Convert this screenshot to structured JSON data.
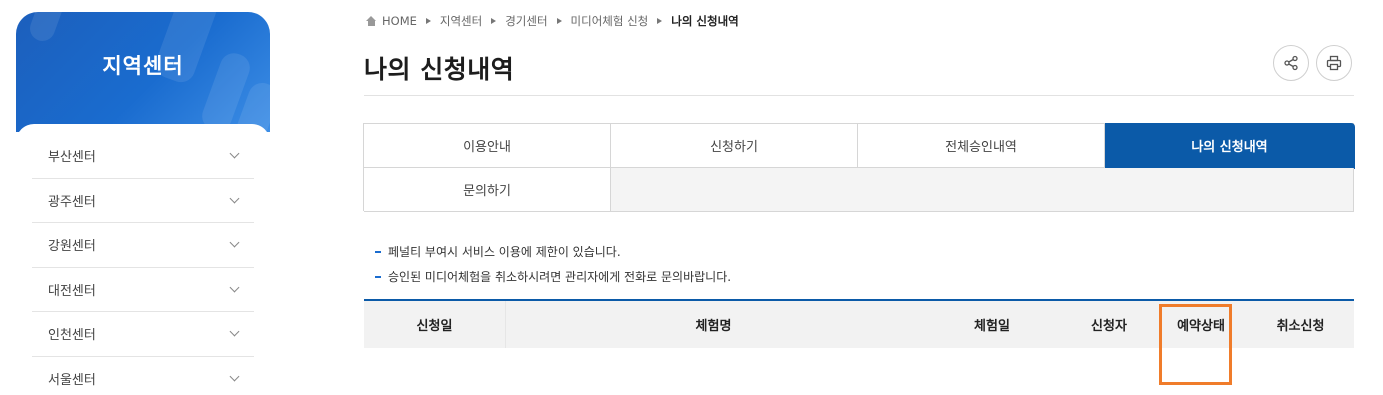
{
  "sidebar": {
    "title": "지역센터",
    "items": [
      {
        "label": "부산센터"
      },
      {
        "label": "광주센터"
      },
      {
        "label": "강원센터"
      },
      {
        "label": "대전센터"
      },
      {
        "label": "인천센터"
      },
      {
        "label": "서울센터"
      }
    ]
  },
  "breadcrumb": {
    "home": "HOME",
    "items": [
      "지역센터",
      "경기센터",
      "미디어체험 신청"
    ],
    "current": "나의 신청내역"
  },
  "page": {
    "title": "나의 신청내역"
  },
  "tabs": {
    "row1": [
      "이용안내",
      "신청하기",
      "전체승인내역",
      "나의 신청내역"
    ],
    "row2": [
      "문의하기"
    ],
    "active": "나의 신청내역"
  },
  "notices": [
    "페널티 부여시 서비스 이용에 제한이 있습니다.",
    "승인된 미디어체험을 취소하시려면 관리자에게 전화로 문의바랍니다."
  ],
  "table": {
    "columns": [
      "신청일",
      "체험명",
      "체험일",
      "신청자",
      "예약상태",
      "취소신청"
    ]
  },
  "icons": {
    "share": "share-icon",
    "print": "print-icon",
    "home": "home-icon",
    "chevron": "chevron-down-icon"
  },
  "colors": {
    "primary": "#0b5aa8",
    "sidebar_gradient": "#1c5fbc",
    "highlight": "#f07c2a"
  }
}
